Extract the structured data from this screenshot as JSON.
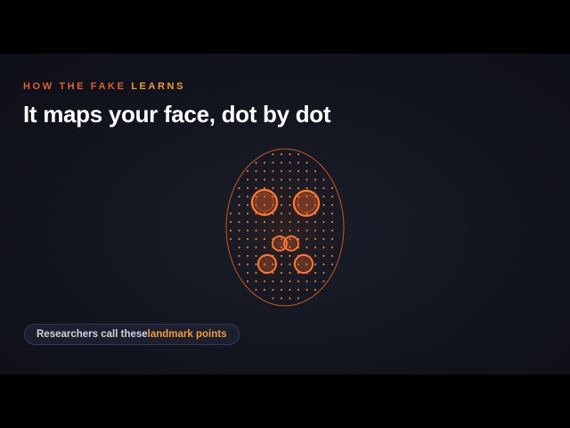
{
  "kicker": {
    "prefix": "HOW THE FAKE ",
    "highlight": "LEARNS"
  },
  "headline": "It maps your face, dot by dot",
  "caption": {
    "prefix": "Researchers call these ",
    "highlight": "landmark points"
  },
  "colors": {
    "background": "#12141e",
    "accent": "#e0602c",
    "highlight": "#f39a3c",
    "text": "#ffffff"
  },
  "face_graphic": {
    "outline": "face-oval",
    "landmark_groups": [
      "left-eye",
      "right-eye",
      "left-nostril",
      "right-nostril",
      "left-mouth-corner",
      "right-mouth-corner"
    ]
  }
}
